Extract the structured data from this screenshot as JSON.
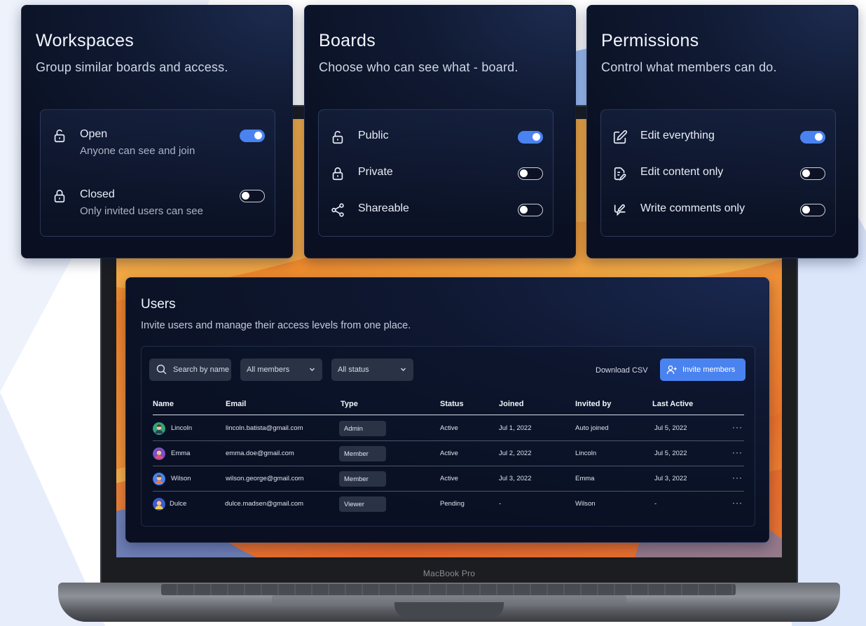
{
  "colors": {
    "accent": "#4a83f0",
    "card_bg": "#0f1831",
    "screen": "#f08a2c"
  },
  "laptop": {
    "label": "MacBook Pro"
  },
  "cards": [
    {
      "title": "Workspaces",
      "subtitle": "Group similar boards and access.",
      "options": [
        {
          "icon": "unlock-icon",
          "label": "Open",
          "description": "Anyone can see and join",
          "enabled": true
        },
        {
          "icon": "lock-icon",
          "label": "Closed",
          "description": "Only invited users can see",
          "enabled": false
        }
      ]
    },
    {
      "title": "Boards",
      "subtitle": "Choose who can see what - board.",
      "options": [
        {
          "icon": "unlock-icon",
          "label": "Public",
          "enabled": true
        },
        {
          "icon": "lock-icon",
          "label": "Private",
          "enabled": false
        },
        {
          "icon": "share-icon",
          "label": "Shareable",
          "enabled": false
        }
      ]
    },
    {
      "title": "Permissions",
      "subtitle": "Control what members can do.",
      "options": [
        {
          "icon": "edit-icon",
          "label": "Edit everything",
          "enabled": true
        },
        {
          "icon": "document-edit-icon",
          "label": "Edit content only",
          "enabled": false
        },
        {
          "icon": "comment-edit-icon",
          "label": "Write comments only",
          "enabled": false
        }
      ]
    }
  ],
  "users": {
    "title": "Users",
    "subtitle": "Invite users and manage their access levels from one place.",
    "search_placeholder": "Search by name",
    "filter_members": "All members",
    "filter_status": "All status",
    "download_label": "Download CSV",
    "invite_label": "Invite members",
    "columns": [
      "Name",
      "Email",
      "Type",
      "Status",
      "Joined",
      "Invited by",
      "Last Active"
    ],
    "rows": [
      {
        "name": "Lincoln",
        "email": "lincoln.batista@gmail.com",
        "type": "Admin",
        "status": "Active",
        "joined": "Jul 1, 2022",
        "invited_by": "Auto joined",
        "last_active": "Jul 5, 2022",
        "more": "···"
      },
      {
        "name": "Emma",
        "email": "emma.doe@gmail.com",
        "type": "Member",
        "status": "Active",
        "joined": "Jul 2, 2022",
        "invited_by": "Lincoln",
        "last_active": "Jul 5, 2022",
        "more": "···"
      },
      {
        "name": "Wilson",
        "email": "wilson.george@gmail.com",
        "type": "Member",
        "status": "Active",
        "joined": "Jul 3, 2022",
        "invited_by": "Emma",
        "last_active": "Jul 3, 2022",
        "more": "···"
      },
      {
        "name": "Dulce",
        "email": "dulce.madsen@gmail.com",
        "type": "Viewer",
        "status": "Pending",
        "joined": "-",
        "invited_by": "Wilson",
        "last_active": "-",
        "more": "···"
      }
    ]
  }
}
